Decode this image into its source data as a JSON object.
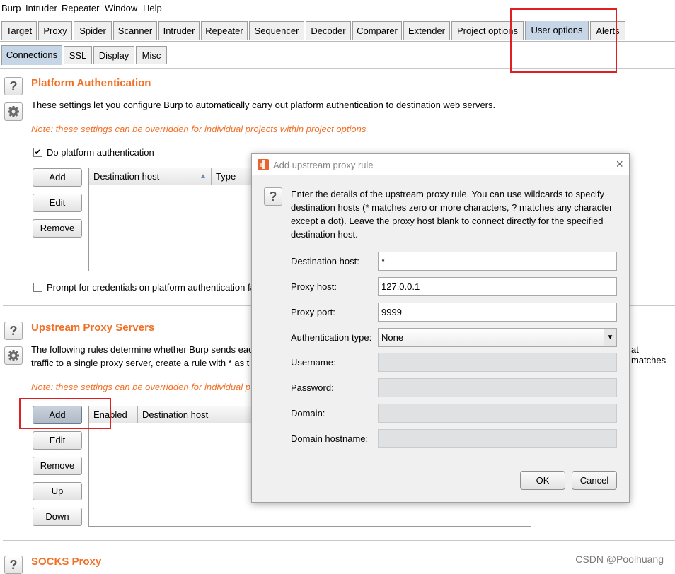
{
  "menu": [
    "Burp",
    "Intruder",
    "Repeater",
    "Window",
    "Help"
  ],
  "top_tabs": [
    "Target",
    "Proxy",
    "Spider",
    "Scanner",
    "Intruder",
    "Repeater",
    "Sequencer",
    "Decoder",
    "Comparer",
    "Extender",
    "Project options",
    "User options",
    "Alerts"
  ],
  "active_top_tab": "User options",
  "sub_tabs": [
    "Connections",
    "SSL",
    "Display",
    "Misc"
  ],
  "active_sub_tab": "Connections",
  "platform_auth": {
    "title": "Platform Authentication",
    "description": "These settings let you configure Burp to automatically carry out platform authentication to destination web servers.",
    "note": "Note: these settings can be overridden for individual projects within project options.",
    "checkbox_label": "Do platform authentication",
    "checkbox_checked": true,
    "buttons": [
      "Add",
      "Edit",
      "Remove"
    ],
    "columns": [
      "Destination host",
      "Type"
    ],
    "prompt_label": "Prompt for credentials on platform authentication fa",
    "prompt_checked": false
  },
  "upstream": {
    "title": "Upstream Proxy Servers",
    "description_line1": "The following rules determine whether Burp sends eac",
    "description_line1_tail": "at matches",
    "description_line2": "traffic to a single proxy server, create a rule with * as t",
    "note": "Note: these settings can be overridden for individual p",
    "buttons": [
      "Add",
      "Edit",
      "Remove",
      "Up",
      "Down"
    ],
    "columns": [
      "Enabled",
      "Destination host"
    ]
  },
  "socks": {
    "title": "SOCKS Proxy"
  },
  "dialog": {
    "title": "Add upstream proxy rule",
    "close_glyph": "×",
    "intro": [
      "Enter the details of the upstream proxy rule. You can use wildcards to specify",
      "destination hosts (* matches zero or more characters, ? matches any character",
      "except a dot). Leave the proxy host blank to connect directly for the specified",
      "destination host."
    ],
    "fields": {
      "destination_host": {
        "label": "Destination host:",
        "value": "*"
      },
      "proxy_host": {
        "label": "Proxy host:",
        "value": "127.0.0.1"
      },
      "proxy_port": {
        "label": "Proxy port:",
        "value": "9999"
      },
      "auth_type": {
        "label": "Authentication type:",
        "value": "None"
      },
      "username": {
        "label": "Username:",
        "value": ""
      },
      "password": {
        "label": "Password:",
        "value": ""
      },
      "domain": {
        "label": "Domain:",
        "value": ""
      },
      "domain_hostname": {
        "label": "Domain hostname:",
        "value": ""
      }
    },
    "ok_label": "OK",
    "cancel_label": "Cancel"
  },
  "watermark": "CSDN @Poolhuang",
  "colors": {
    "accent_orange": "#f26f26",
    "highlight_red": "#e02020",
    "active_tab": "#c7d6e6"
  }
}
